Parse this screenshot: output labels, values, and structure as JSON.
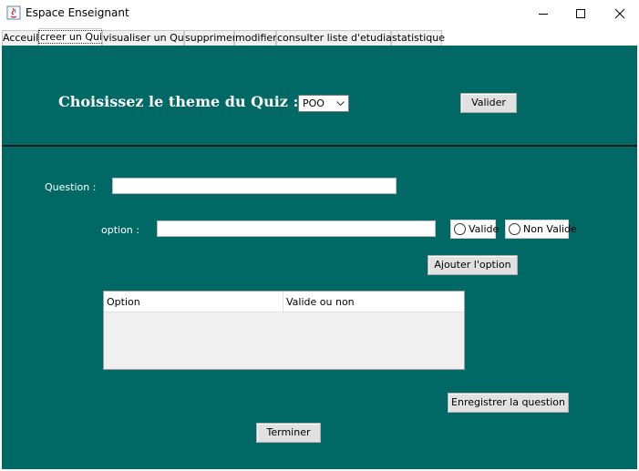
{
  "window": {
    "title": "Espace Enseignant",
    "icons": [
      "java-app-icon",
      "minimize-icon",
      "maximize-icon",
      "close-icon"
    ]
  },
  "tabs": [
    {
      "label": "Acceuil",
      "active": false
    },
    {
      "label": "creer un Quiz",
      "active": true
    },
    {
      "label": "visualiser un Quiz",
      "active": false
    },
    {
      "label": "supprimer",
      "active": false
    },
    {
      "label": "modifier",
      "active": false
    },
    {
      "label": "consulter liste d'etudiants",
      "active": false
    },
    {
      "label": "statistique",
      "active": false
    }
  ],
  "theme_section": {
    "heading": "Choisissez le theme du Quiz :",
    "theme_select": {
      "selected": "POO"
    },
    "validate_button": "Valider"
  },
  "question_form": {
    "question_label": "Question :",
    "question_value": "",
    "option_label": "option :",
    "option_value": "",
    "radio_valid": "Valide",
    "radio_invalid": "Non Valide",
    "add_option_button": "Ajouter l'option"
  },
  "options_table": {
    "columns": [
      "Option",
      "Valide ou non"
    ],
    "rows": []
  },
  "actions": {
    "save_question_button": "Enregistrer la question",
    "finish_button": "Terminer"
  },
  "colors": {
    "panel_background": "#006966",
    "divider": "#1b1b1b",
    "button_face": "#e1e1e1"
  }
}
